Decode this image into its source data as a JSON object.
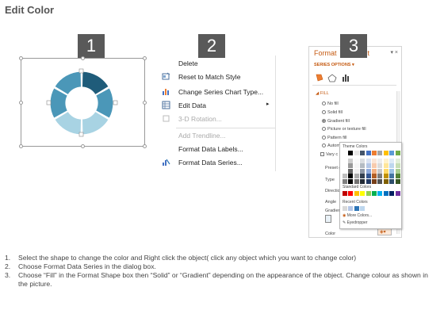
{
  "title": "Edit Color",
  "steps_numbers": [
    "1",
    "2",
    "3"
  ],
  "context_menu": {
    "items": [
      {
        "label": "Delete",
        "icon": "none",
        "disabled": false
      },
      {
        "label": "Reset to Match Style",
        "icon": "reset-style-icon",
        "disabled": false
      },
      {
        "label": "Change Series Chart Type...",
        "icon": "chart-type-icon",
        "disabled": false
      },
      {
        "label": "Edit Data",
        "icon": "edit-data-icon",
        "disabled": false,
        "submenu": true
      },
      {
        "label": "3-D Rotation...",
        "icon": "rotation-icon",
        "disabled": true
      },
      {
        "label": "Add Trendline...",
        "icon": "none",
        "disabled": true
      },
      {
        "label": "Format Data Labels...",
        "icon": "none",
        "disabled": false
      },
      {
        "label": "Format Data Series...",
        "icon": "format-series-icon",
        "disabled": false
      }
    ]
  },
  "format_pane": {
    "title": "Format",
    "title_tail": "oint",
    "close": "▾ ×",
    "series_options": "SERIES OPTIONS ▾",
    "fill_header": "◢ FILL",
    "fill_options": [
      {
        "label": "No fill",
        "selected": false
      },
      {
        "label": "Solid fill",
        "selected": false
      },
      {
        "label": "Gradient fill",
        "selected": true
      },
      {
        "label": "Picture or texture fill",
        "selected": false
      },
      {
        "label": "Pattern fill",
        "selected": false
      },
      {
        "label": "Autom",
        "selected": false
      }
    ],
    "vary_colors": "Vary c",
    "labels": [
      "Preset g",
      "Type",
      "Directio",
      "Angle",
      "Gradien"
    ],
    "color_label": "Color"
  },
  "color_palette": {
    "theme_header": "Theme Colors",
    "standard_header": "Standard Colors",
    "recent_header": "Recent Colors",
    "more_colors": "More Colors...",
    "eyedropper": "Eyedropper",
    "theme_row": [
      "#ffffff",
      "#000000",
      "#e7e6e6",
      "#44546a",
      "#4472c4",
      "#ed7d31",
      "#a5a5a5",
      "#ffc000",
      "#5b9bd5",
      "#70ad47"
    ],
    "standard_row": [
      "#c00000",
      "#ff0000",
      "#ffc000",
      "#ffff00",
      "#92d050",
      "#00b050",
      "#00b0f0",
      "#0070c0",
      "#002060",
      "#7030a0"
    ],
    "recent_row": [
      "#d9d9d9",
      "#b4c7e7",
      "#2e75b6",
      "#bdd7ee"
    ]
  },
  "instructions": [
    {
      "n": "1.",
      "text": "Select the shape to change the color and Right click the object( click any object which you want to change color)"
    },
    {
      "n": "2.",
      "text": "Choose Format Data Series in the dialog box."
    },
    {
      "n": "3.",
      "text": "Choose “Fill” in the Format Shape box then “Solid” or “Gradient” depending on the appearance of the object. Change colour as shown in the picture."
    }
  ],
  "colors": {
    "donut_dark": "#1f5c7a",
    "donut_mid": "#4b97b8",
    "donut_light": "#a8d3e3",
    "accent_orange": "#c55a11",
    "badge_bg": "#595959"
  }
}
